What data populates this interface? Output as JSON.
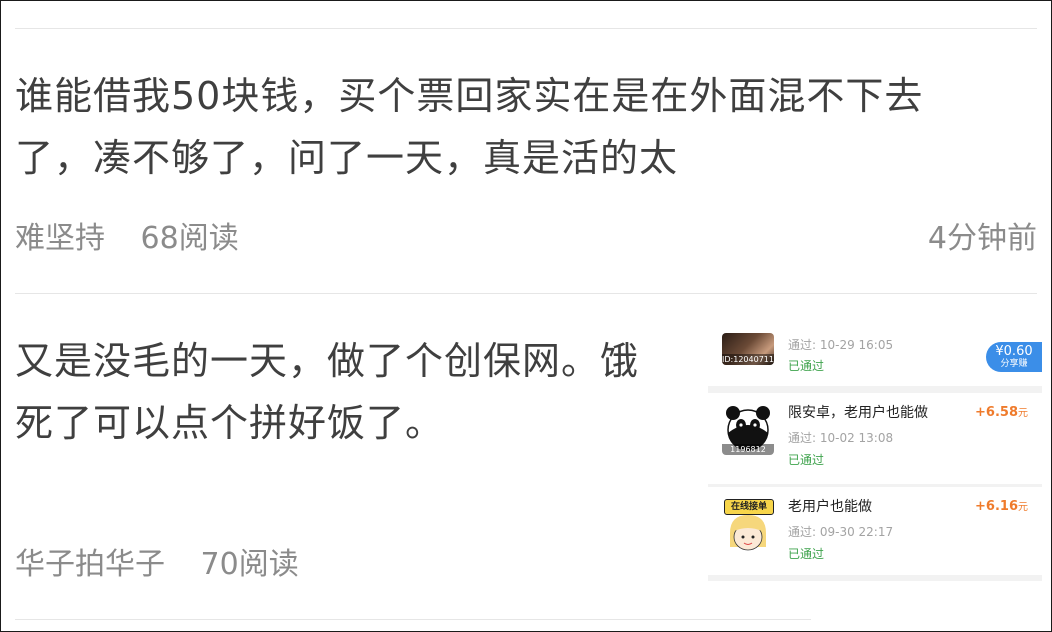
{
  "posts": [
    {
      "title_line1": "谁能借我50块钱，买个票回家实在是在外面混不下去",
      "title_line2": "了，凑不够了，问了一天，真是活的太",
      "author": "难坚持",
      "reads": "68阅读",
      "time": "4分钟前"
    },
    {
      "title_line1": "又是没毛的一天，做了个创保网。饿",
      "title_line2": "死了可以点个拼好饭了。",
      "author": "华子拍华子",
      "reads": "70阅读"
    }
  ],
  "thumbnail": {
    "rows": [
      {
        "avatar_id": "ID:12040711",
        "time": "通过:  10-29 16:05",
        "status": "已通过",
        "badge_amount": "¥0.60",
        "badge_label": "分享赚"
      },
      {
        "title": "限安卓，老用户也能做",
        "avatar_id": "1196812",
        "time": "通过:  10-02 13:08",
        "status": "已通过",
        "reward": "+6.58",
        "reward_unit": "元"
      },
      {
        "title": "老用户也能做",
        "avatar_caption": "在线接单",
        "time": "通过:  09-30 22:17",
        "status": "已通过",
        "reward": "+6.16",
        "reward_unit": "元"
      }
    ]
  },
  "colors": {
    "title_text": "#3f3f3f",
    "meta_text": "#8b8b8b",
    "reward": "#ef7b2c",
    "approved": "#3fa34d",
    "badge_bg": "#3b8ee8"
  }
}
